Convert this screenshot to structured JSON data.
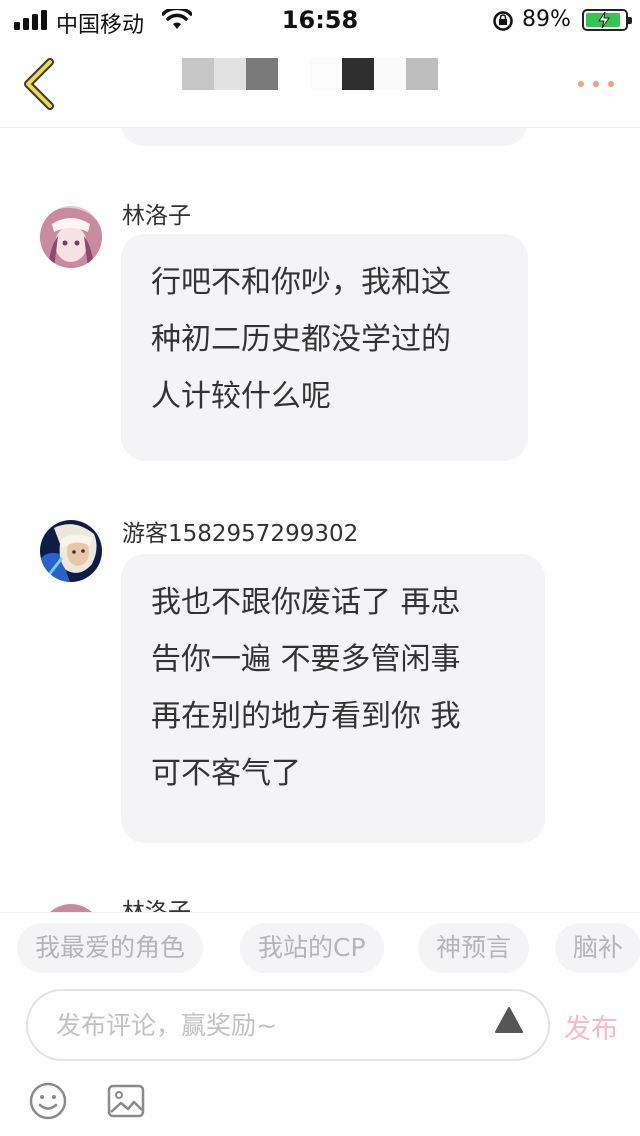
{
  "status_bar": {
    "carrier": "中国移动",
    "time": "16:58",
    "battery_percent": "89%",
    "battery_level": 0.89
  },
  "nav": {
    "back_icon": "chevron-left-icon",
    "more_icon": "more-dots-icon",
    "accent_color": "#f0a080"
  },
  "messages": [
    {
      "sender": "林洛子",
      "lines": [
        "行吧不和你吵，我和这",
        "种初二历史都没学过的",
        "人计较什么呢"
      ]
    },
    {
      "sender": "游客1582957299302",
      "lines": [
        "我也不跟你废话了 再忠",
        "告你一遍 不要多管闲事",
        "再在别的地方看到你 我",
        "可不客气了"
      ]
    },
    {
      "sender": "林洛子",
      "lines": []
    }
  ],
  "quick_chips": [
    "我最爱的角色",
    "我站的CP",
    "神预言",
    "脑补"
  ],
  "input": {
    "placeholder": "发布评论，赢奖励~",
    "value": "",
    "publish_label": "发布",
    "publish_color": "#f6b9c6"
  },
  "toolbar_icons": [
    "emoji-icon",
    "image-icon",
    "triangle-up-icon"
  ]
}
